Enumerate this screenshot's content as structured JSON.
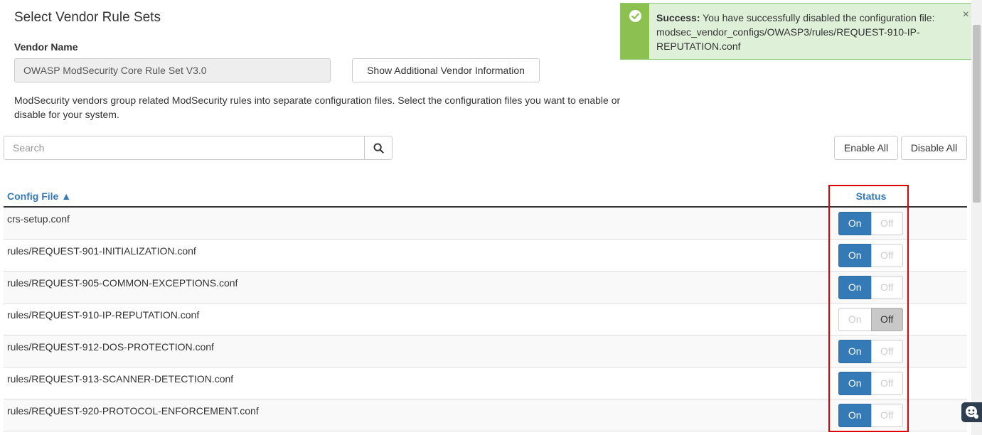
{
  "page": {
    "title": "Select Vendor Rule Sets"
  },
  "vendor": {
    "label": "Vendor Name",
    "value": "OWASP ModSecurity Core Rule Set V3.0",
    "info_button": "Show Additional Vendor Information"
  },
  "description": "ModSecurity vendors group related ModSecurity rules into separate configuration files. Select the configuration files you want to enable or disable for your system.",
  "search": {
    "placeholder": "Search",
    "icon": "search-icon"
  },
  "actions": {
    "enable_all": "Enable All",
    "disable_all": "Disable All"
  },
  "table": {
    "col_config": "Config File ▲",
    "col_status": "Status",
    "on_label": "On",
    "off_label": "Off",
    "rows": [
      {
        "name": "crs-setup.conf",
        "status": "On"
      },
      {
        "name": "rules/REQUEST-901-INITIALIZATION.conf",
        "status": "On"
      },
      {
        "name": "rules/REQUEST-905-COMMON-EXCEPTIONS.conf",
        "status": "On"
      },
      {
        "name": "rules/REQUEST-910-IP-REPUTATION.conf",
        "status": "Off"
      },
      {
        "name": "rules/REQUEST-912-DOS-PROTECTION.conf",
        "status": "On"
      },
      {
        "name": "rules/REQUEST-913-SCANNER-DETECTION.conf",
        "status": "On"
      },
      {
        "name": "rules/REQUEST-920-PROTOCOL-ENFORCEMENT.conf",
        "status": "On"
      }
    ]
  },
  "alert": {
    "title": "Success:",
    "message": "You have successfully disabled the configuration file: modsec_vendor_configs/OWASP3/rules/REQUEST-910-IP-REPUTATION.conf",
    "close": "×",
    "icon": "check-circle-icon"
  },
  "colors": {
    "primary": "#337ab7",
    "success_bg": "#dff0d8",
    "success_strip": "#8cc152",
    "highlight": "#e00000"
  }
}
